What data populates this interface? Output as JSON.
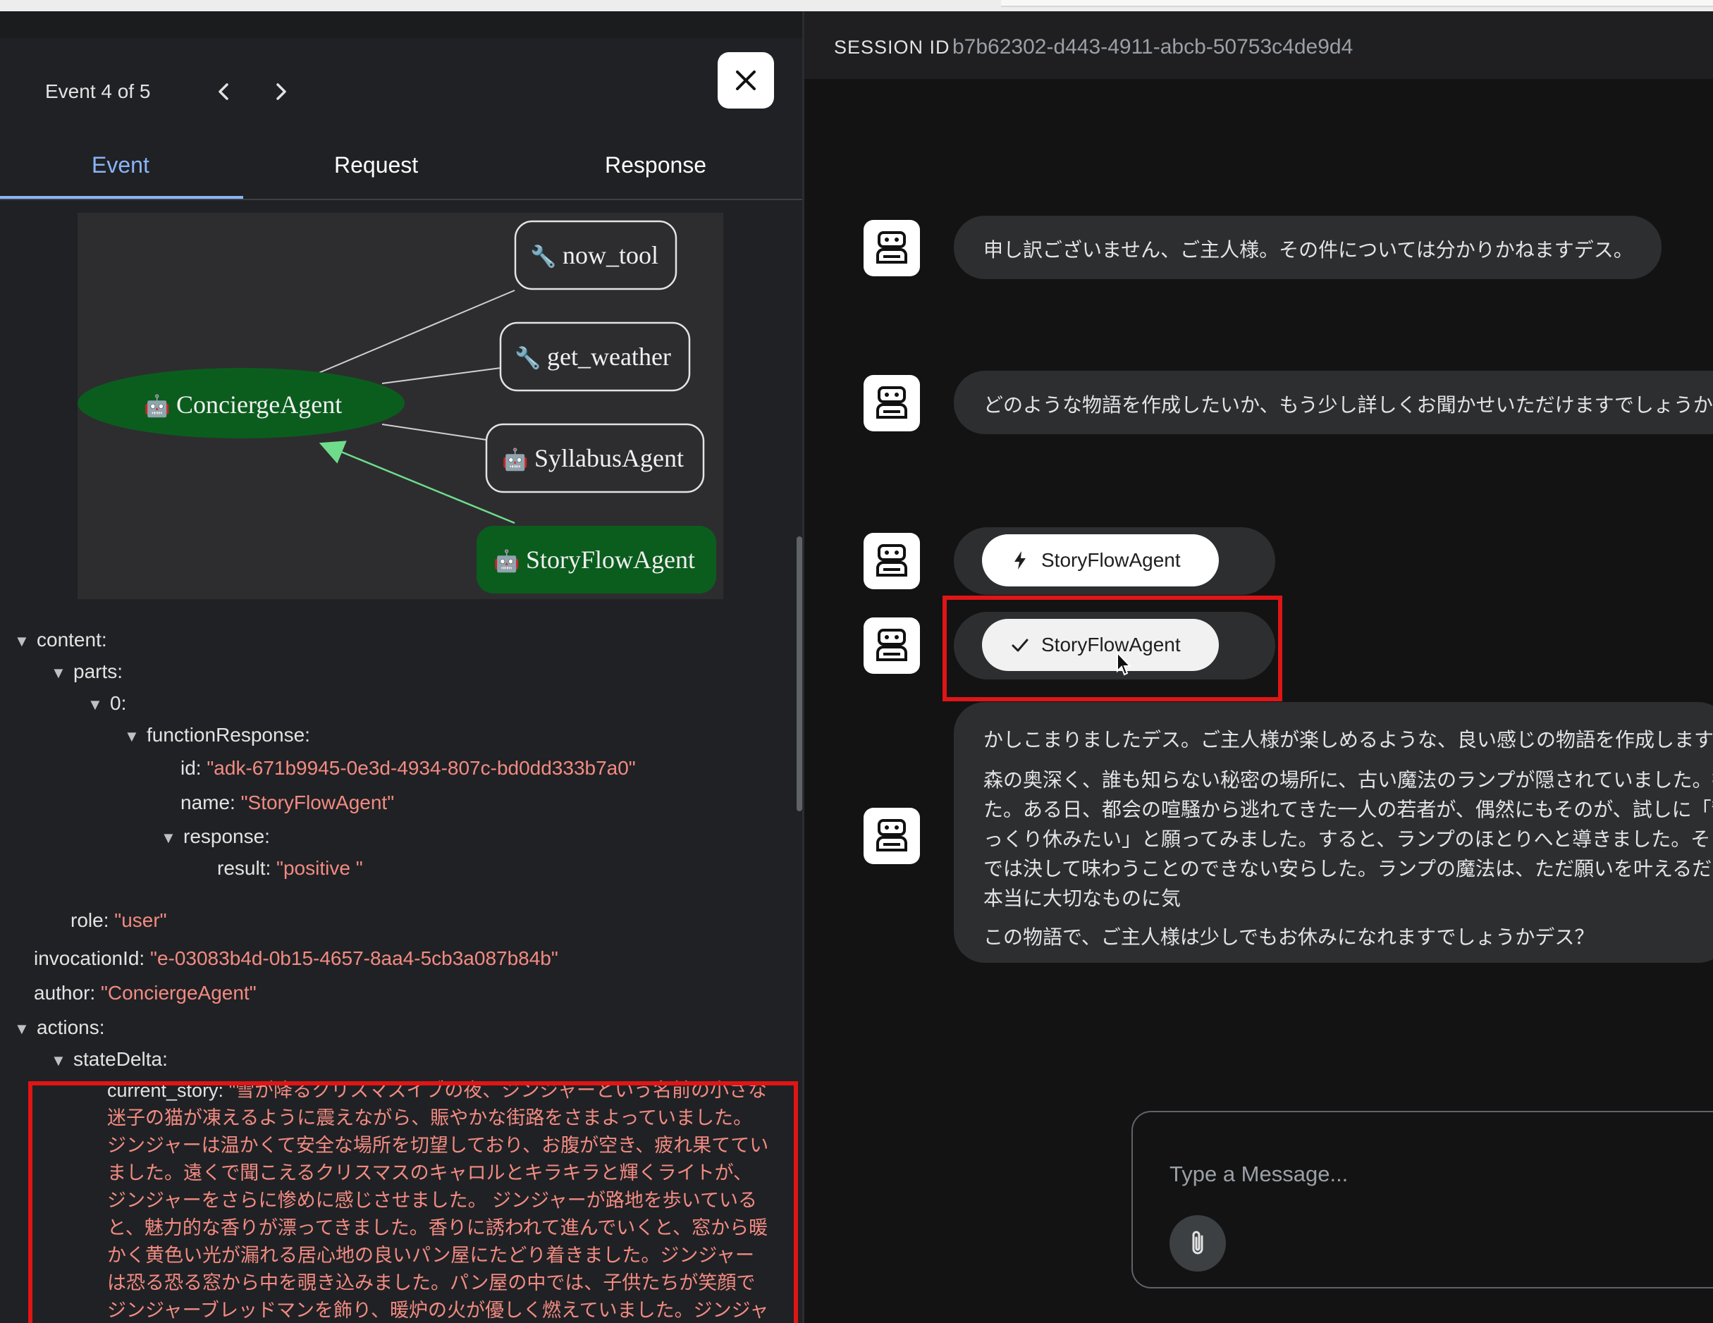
{
  "event_nav": {
    "label": "Event 4 of 5"
  },
  "tabs": [
    {
      "label": "Event"
    },
    {
      "label": "Request"
    },
    {
      "label": "Response"
    }
  ],
  "graph": {
    "nodes": [
      {
        "name": "now_tool",
        "kind": "tool"
      },
      {
        "name": "get_weather",
        "kind": "tool"
      },
      {
        "name": "ConciergeAgent",
        "kind": "agent"
      },
      {
        "name": "SyllabusAgent",
        "kind": "agent"
      },
      {
        "name": "StoryFlowAgent",
        "kind": "agent"
      }
    ],
    "colors": {
      "active_node": "#0b5d1e",
      "active_edge": "#6fdc8c",
      "edge": "#d0d0d0"
    }
  },
  "tree": {
    "content_key": "content:",
    "parts_key": "parts:",
    "index_key": "0:",
    "function_response_key": "functionResponse:",
    "id_key": "id:",
    "id_value": "\"adk-671b9945-0e3d-4934-807c-bd0dd333b7a0\"",
    "name_key": "name:",
    "name_value": "\"StoryFlowAgent\"",
    "response_key": "response:",
    "result_key": "result:",
    "result_value": "\"positive \"",
    "role_key": "role:",
    "role_value": "\"user\"",
    "invocation_key": "invocationId:",
    "invocation_value": "\"e-03083b4d-0b15-4657-8aa4-5cb3a087b84b\"",
    "author_key": "author:",
    "author_value": "\"ConciergeAgent\"",
    "actions_key": "actions:",
    "state_delta_key": "stateDelta:",
    "current_story_key": "current_story:",
    "current_story_value": "\"雪が降るクリスマスイブの夜、ジンジャーという名前の小さな迷子の猫が凍えるように震えながら、賑やかな街路をさまよっていました。ジンジャーは温かくて安全な場所を切望しており、お腹が空き、疲れ果てていました。遠くで聞こえるクリスマスのキャロルとキラキラと輝くライトが、ジンジャーをさらに惨めに感じさせました。 ジンジャーが路地を歩いていると、魅力的な香りが漂ってきました。香りに誘われて進んでいくと、窓から暖かく黄色い光が漏れる居心地の良いパン屋にたどり着きました。ジンジャーは恐る恐る窓から中を覗き込みました。パン屋の中では、子供たちが笑顔でジンジャーブレッドマンを飾り、暖炉の火が優しく燃えていました。ジンジャーはため息をつきました。"
  },
  "session": {
    "label": "SESSION ID",
    "id": "b7b62302-d443-4911-abcb-50753c4de9d4"
  },
  "chat": {
    "msg1": "申し訳ございません、ご主人様。その件については分かりかねますデス。",
    "msg2": "どのような物語を作成したいか、もう少し詳しくお聞かせいただけますでしょうか",
    "function_call_chip": "StoryFlowAgent",
    "function_response_chip": "StoryFlowAgent",
    "msg3_p1": "かしこまりましたデス。ご主人様が楽しめるような、良い感じの物語を作成します",
    "msg3_p2": "森の奥深く、誰も知らない秘密の場所に、古い魔法のランプが隠されていました。持っていました。ある日、都会の喧騒から逃れてきた一人の若者が、偶然にもそのが、試しに「静かな場所でゆっくり休みたい」と願ってみました。すると、ランプのほとりへと導きました。そこで彼は、都会では決して味わうことのできない安らした。ランプの魔法は、ただ願いを叶えるだけでなく、彼に本当に大切なものに気",
    "msg3_p3": "この物語で、ご主人様は少しでもお休みになれますでしょうかデス？"
  },
  "composer": {
    "placeholder": "Type a Message..."
  }
}
